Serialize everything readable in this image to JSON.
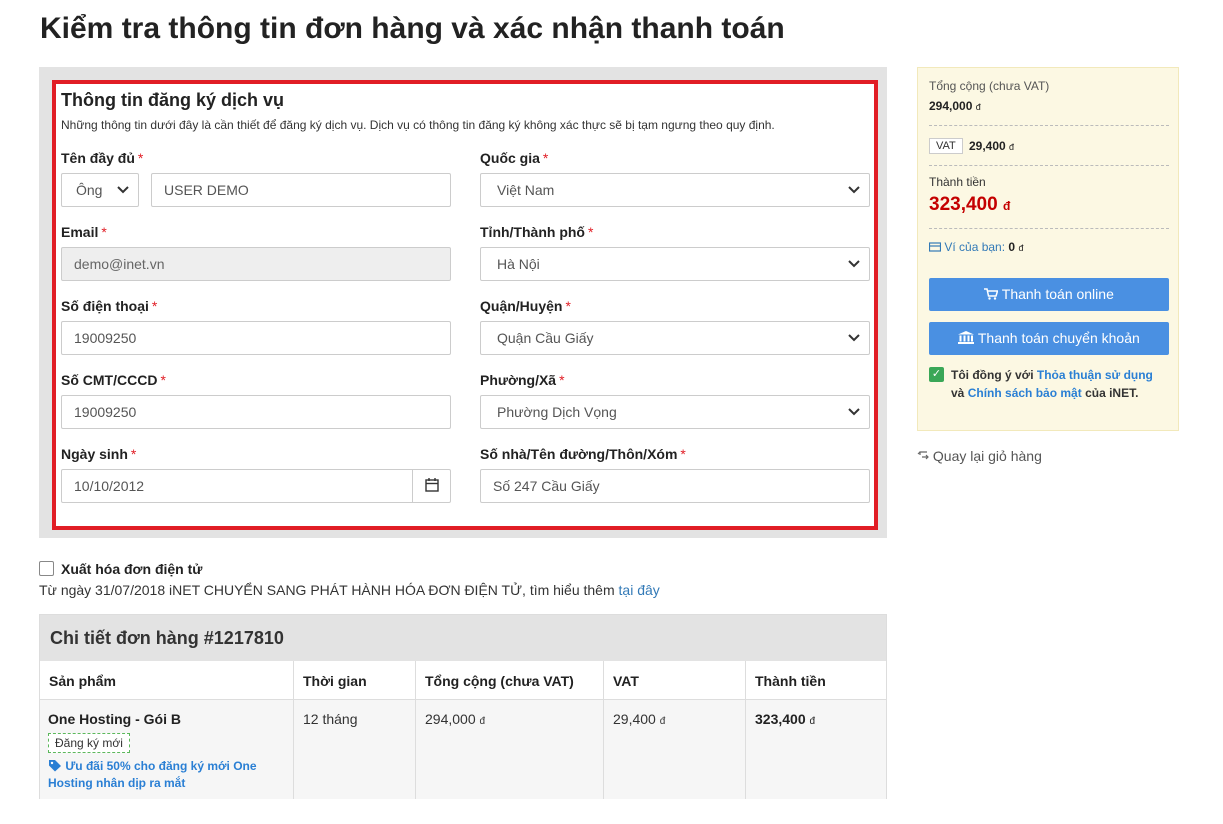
{
  "page": {
    "title": "Kiểm tra thông tin đơn hàng và xác nhận thanh toán"
  },
  "form": {
    "heading": "Thông tin đăng ký dịch vụ",
    "description": "Những thông tin dưới đây là cần thiết để đăng ký dịch vụ. Dịch vụ có thông tin đăng ký không xác thực sẽ bị tạm ngưng theo quy định.",
    "required_mark": "*",
    "full_name": {
      "label": "Tên đầy đủ",
      "title_value": "Ông",
      "value": "USER DEMO"
    },
    "email": {
      "label": "Email",
      "value": "demo@inet.vn"
    },
    "phone": {
      "label": "Số điện thoại",
      "value": "19009250"
    },
    "id_number": {
      "label": "Số CMT/CCCD",
      "value": "19009250"
    },
    "birthday": {
      "label": "Ngày sinh",
      "value": "10/10/2012"
    },
    "country": {
      "label": "Quốc gia",
      "value": "Việt Nam"
    },
    "province": {
      "label": "Tỉnh/Thành phố",
      "value": "Hà Nội"
    },
    "district": {
      "label": "Quận/Huyện",
      "value": "Quận Cầu Giấy"
    },
    "ward": {
      "label": "Phường/Xã",
      "value": "Phường Dịch Vọng"
    },
    "address": {
      "label": "Số nhà/Tên đường/Thôn/Xóm",
      "value": "Số 247 Cầu Giấy"
    }
  },
  "summary": {
    "subtotal_label": "Tổng cộng (chưa VAT)",
    "subtotal_value": "294,000",
    "vat_tag": "VAT",
    "vat_value": "29,400",
    "total_label": "Thành tiền",
    "total_value": "323,400",
    "currency": "đ",
    "wallet_label": "Ví của bạn:",
    "wallet_value": "0",
    "pay_online": "Thanh toán online",
    "pay_transfer": "Thanh toán chuyển khoản",
    "agree_prefix": "Tôi đồng ý với",
    "agree_terms": "Thỏa thuận sử dụng",
    "agree_and": "và",
    "agree_privacy": "Chính sách bảo mật",
    "agree_suffix": "của iNET.",
    "back_link": "Quay lại giỏ hàng"
  },
  "invoice": {
    "label": "Xuất hóa đơn điện tử",
    "note": "Từ ngày 31/07/2018 iNET CHUYỂN SANG PHÁT HÀNH HÓA ĐƠN ĐIỆN TỬ, tìm hiểu thêm",
    "link": "tại đây"
  },
  "order": {
    "title": "Chi tiết đơn hàng #1217810",
    "columns": [
      "Sản phẩm",
      "Thời gian",
      "Tổng cộng (chưa VAT)",
      "VAT",
      "Thành tiền"
    ],
    "row": {
      "product": "One Hosting - Gói B",
      "badge": "Đăng ký mới",
      "promo": "Ưu đãi 50% cho đăng ký mới One Hosting nhân dịp ra mắt",
      "period": "12 tháng",
      "subtotal": "294,000",
      "vat": "29,400",
      "total": "323,400"
    }
  },
  "colors": {
    "accent_red": "#e11d25",
    "button_blue": "#4a90e2",
    "total_red": "#c40000",
    "link_blue": "#2a7fd4"
  }
}
